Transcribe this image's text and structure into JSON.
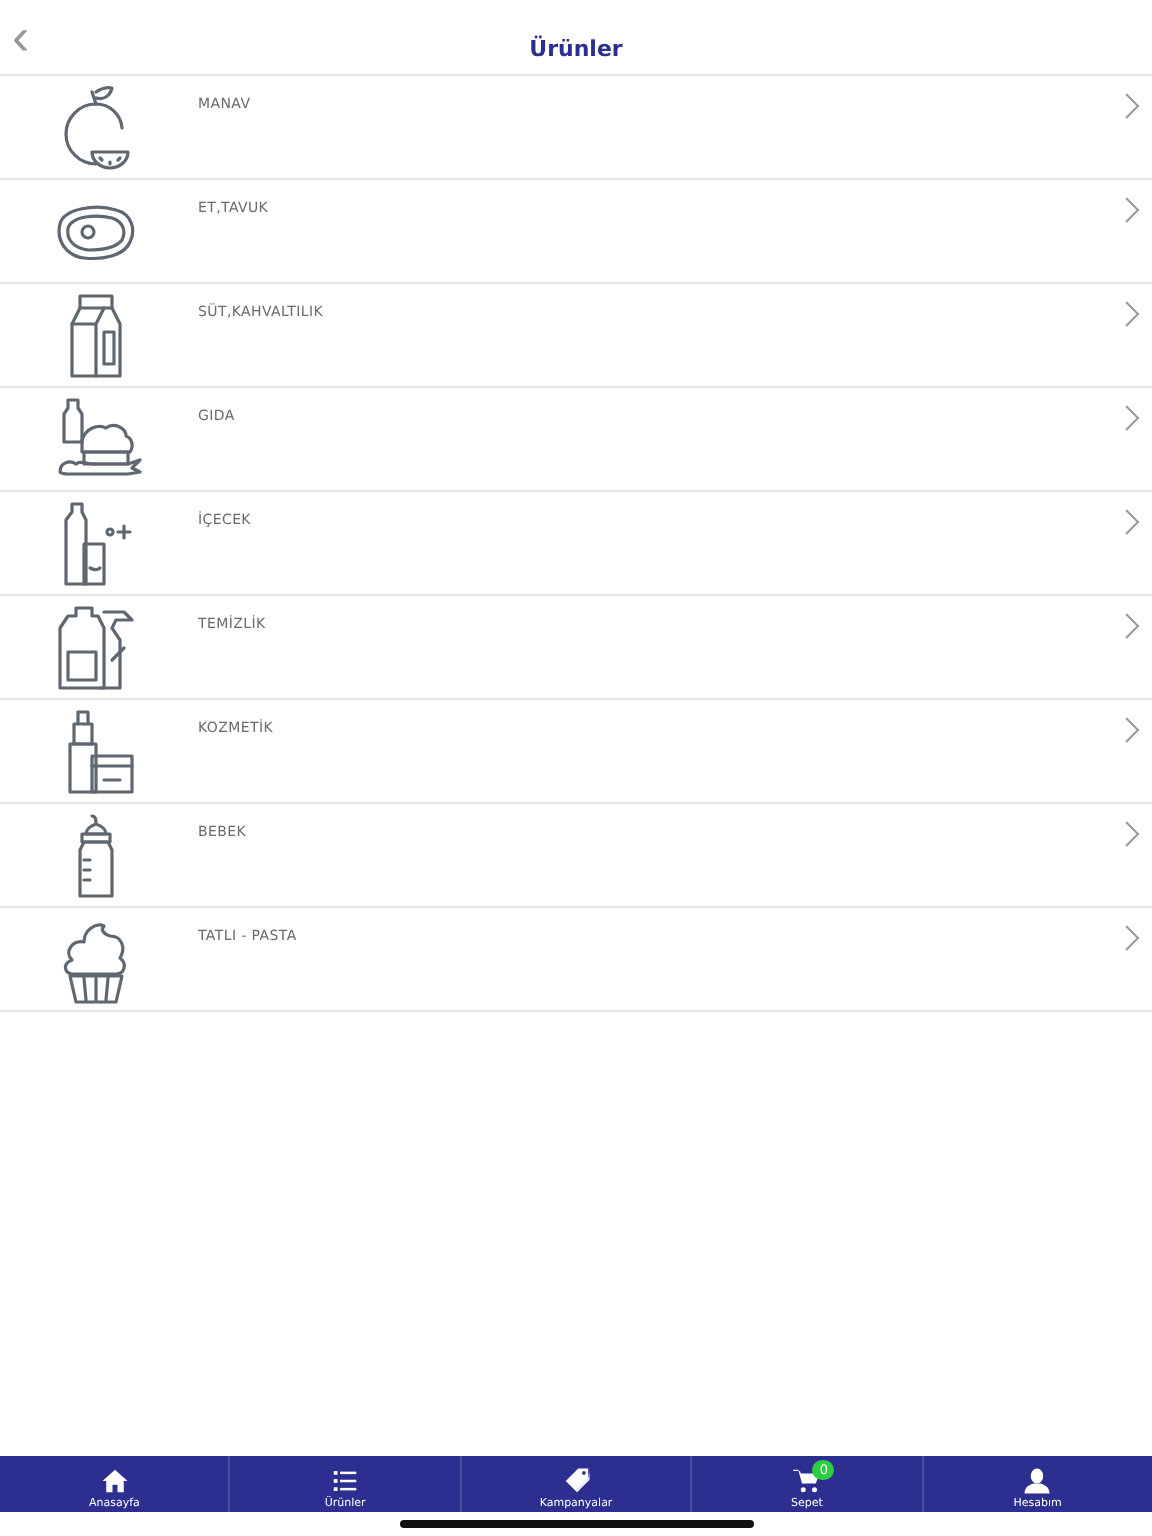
{
  "header": {
    "back": "‹",
    "title": "Ürünler"
  },
  "categories": [
    {
      "label": "MANAV"
    },
    {
      "label": "ET,TAVUK"
    },
    {
      "label": "SÜT,KAHVALTILIK"
    },
    {
      "label": "GIDA"
    },
    {
      "label": "İÇECEK"
    },
    {
      "label": "TEMİZLİK"
    },
    {
      "label": "KOZMETİK"
    },
    {
      "label": "BEBEK"
    },
    {
      "label": "TATLI - PASTA"
    }
  ],
  "tab_bar": [
    {
      "label": "Anasayfa"
    },
    {
      "label": "Ürünler"
    },
    {
      "label": "Kampanyalar"
    },
    {
      "label": "Sepet",
      "badge": "0",
      "color": "#2ecc40"
    },
    {
      "label": "Hesabım"
    }
  ]
}
